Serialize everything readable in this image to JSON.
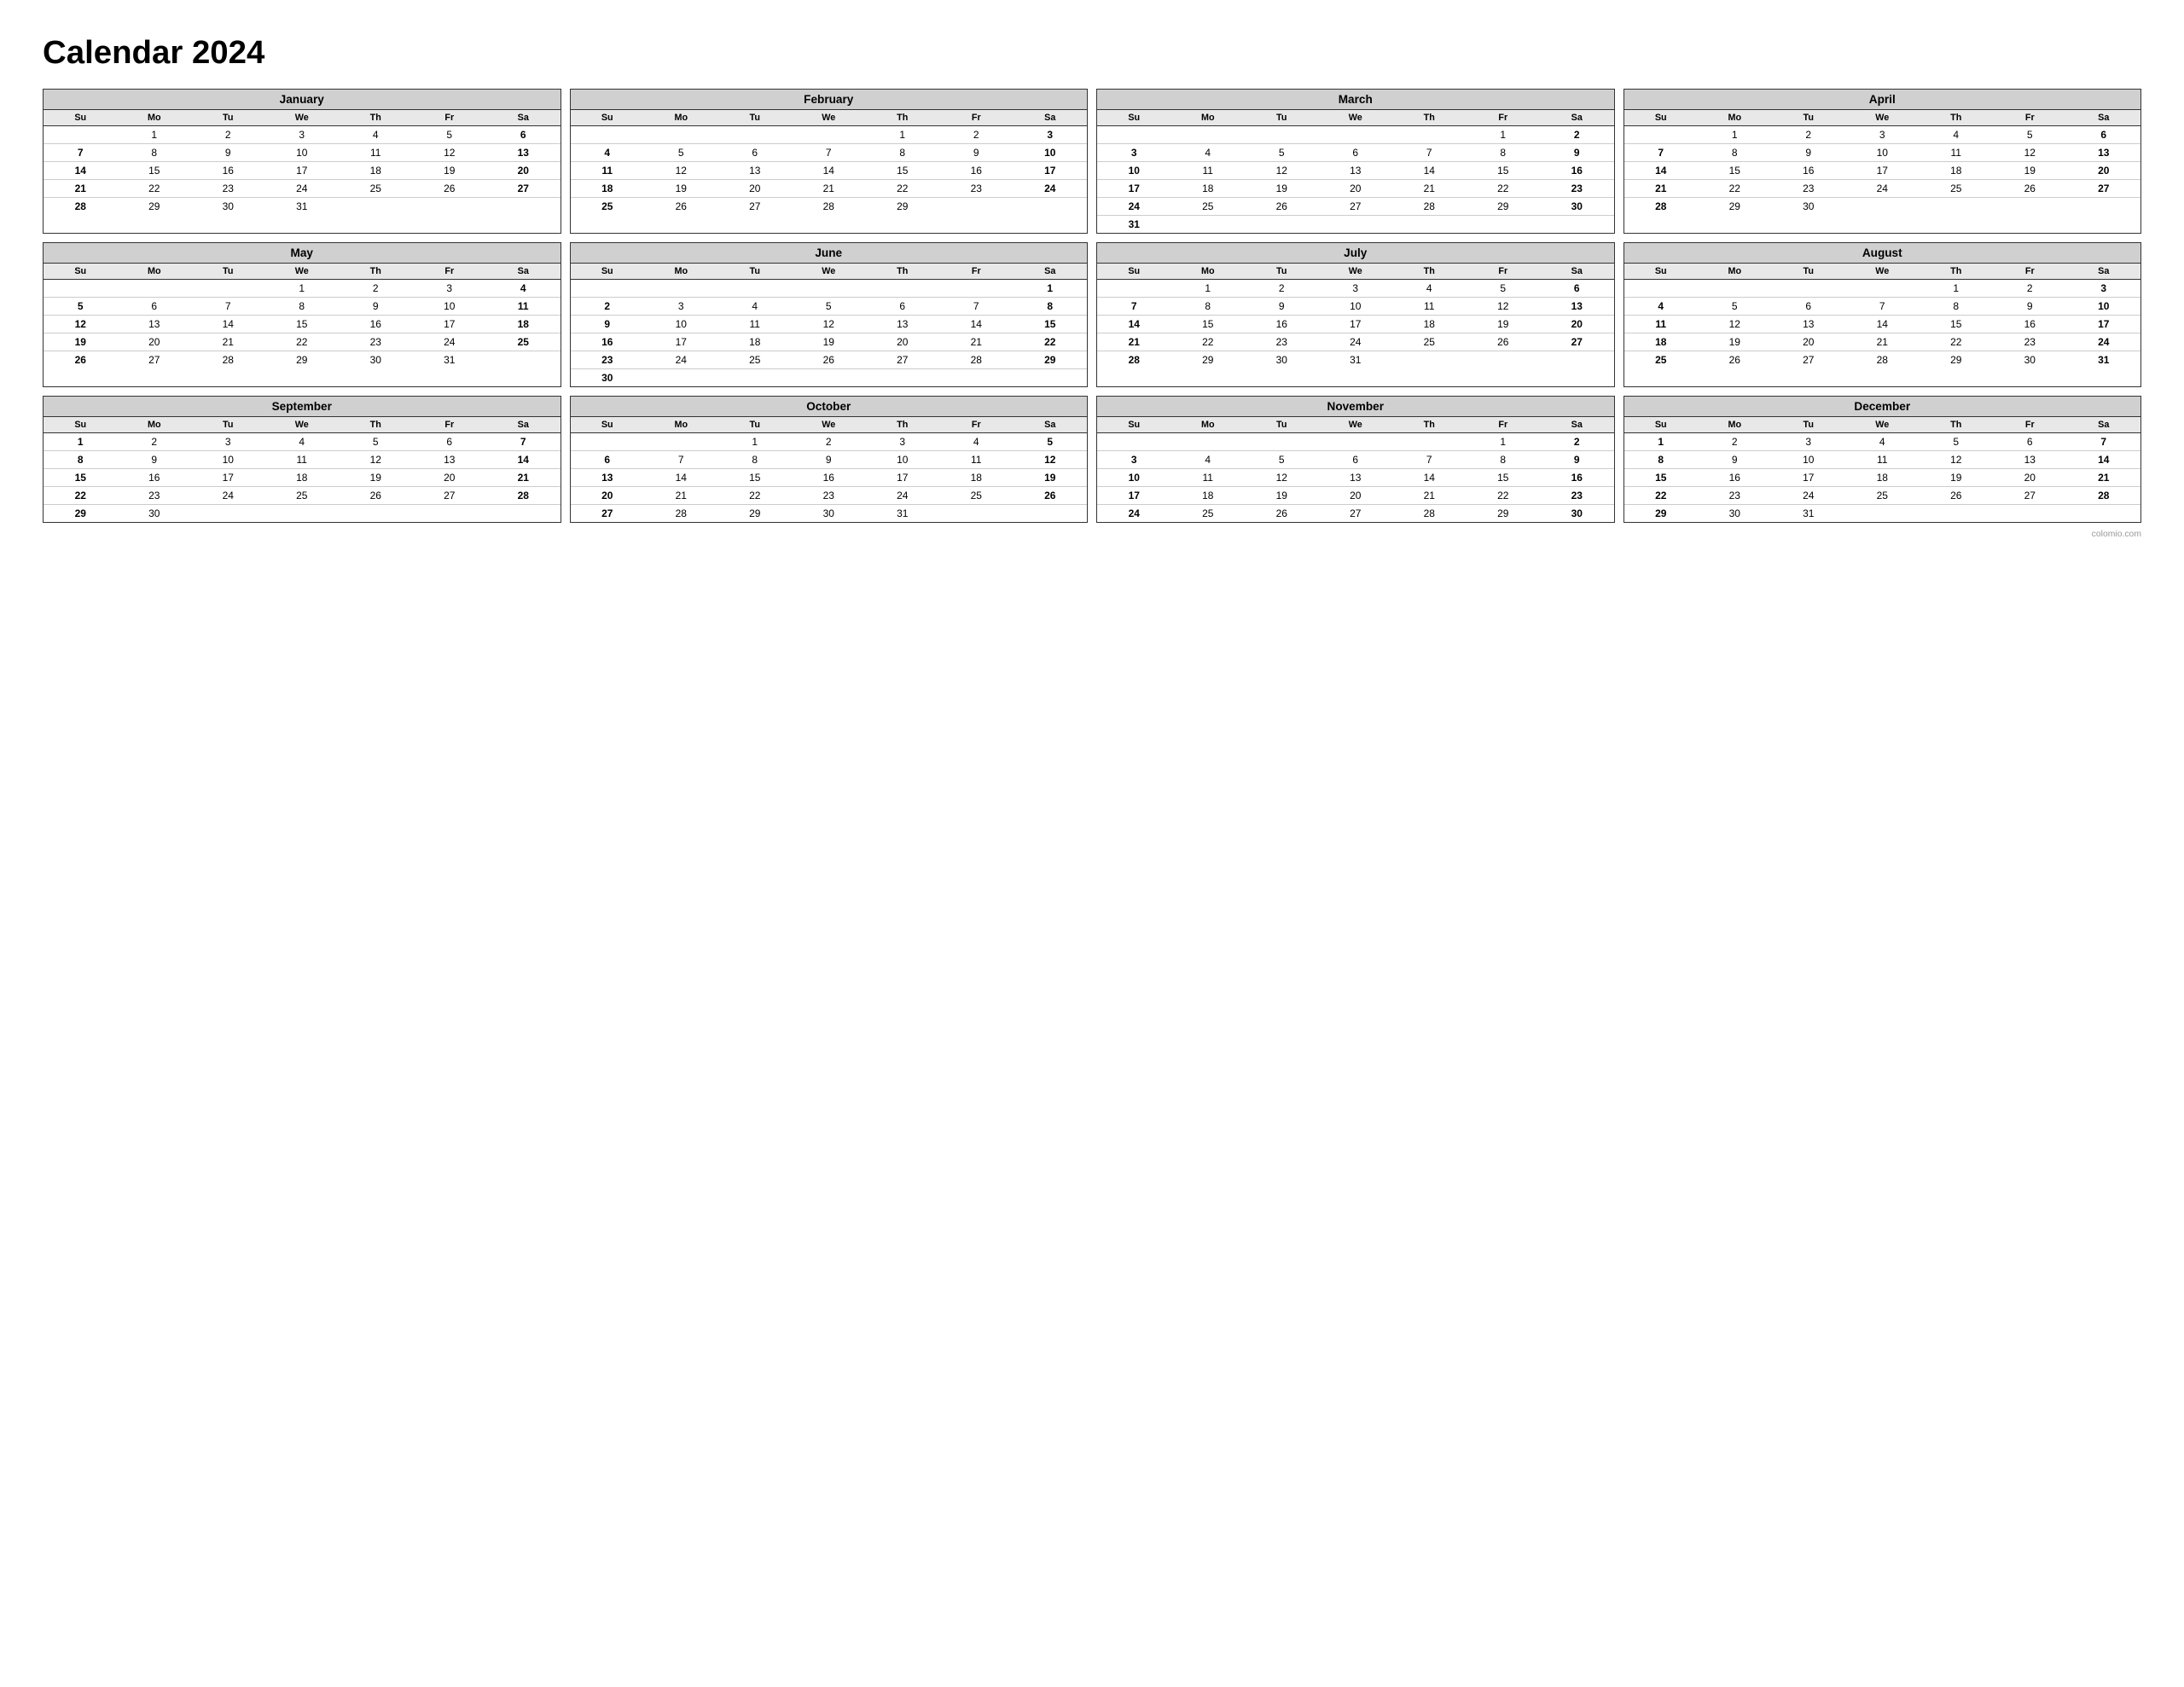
{
  "title": "Calendar 2024",
  "footer": "colomio.com",
  "months": [
    {
      "name": "January",
      "weeks": [
        [
          "",
          "1",
          "2",
          "3",
          "4",
          "5",
          "6"
        ],
        [
          "7",
          "8",
          "9",
          "10",
          "11",
          "12",
          "13"
        ],
        [
          "14",
          "15",
          "16",
          "17",
          "18",
          "19",
          "20"
        ],
        [
          "21",
          "22",
          "23",
          "24",
          "25",
          "26",
          "27"
        ],
        [
          "28",
          "29",
          "30",
          "31",
          "",
          "",
          ""
        ]
      ]
    },
    {
      "name": "February",
      "weeks": [
        [
          "",
          "",
          "",
          "",
          "1",
          "2",
          "3"
        ],
        [
          "4",
          "5",
          "6",
          "7",
          "8",
          "9",
          "10"
        ],
        [
          "11",
          "12",
          "13",
          "14",
          "15",
          "16",
          "17"
        ],
        [
          "18",
          "19",
          "20",
          "21",
          "22",
          "23",
          "24"
        ],
        [
          "25",
          "26",
          "27",
          "28",
          "29",
          "",
          ""
        ]
      ]
    },
    {
      "name": "March",
      "weeks": [
        [
          "",
          "",
          "",
          "",
          "",
          "1",
          "2"
        ],
        [
          "3",
          "4",
          "5",
          "6",
          "7",
          "8",
          "9"
        ],
        [
          "10",
          "11",
          "12",
          "13",
          "14",
          "15",
          "16"
        ],
        [
          "17",
          "18",
          "19",
          "20",
          "21",
          "22",
          "23"
        ],
        [
          "24",
          "25",
          "26",
          "27",
          "28",
          "29",
          "30"
        ],
        [
          "31",
          "",
          "",
          "",
          "",
          "",
          ""
        ]
      ]
    },
    {
      "name": "April",
      "weeks": [
        [
          "",
          "1",
          "2",
          "3",
          "4",
          "5",
          "6"
        ],
        [
          "7",
          "8",
          "9",
          "10",
          "11",
          "12",
          "13"
        ],
        [
          "14",
          "15",
          "16",
          "17",
          "18",
          "19",
          "20"
        ],
        [
          "21",
          "22",
          "23",
          "24",
          "25",
          "26",
          "27"
        ],
        [
          "28",
          "29",
          "30",
          "",
          "",
          "",
          ""
        ]
      ]
    },
    {
      "name": "May",
      "weeks": [
        [
          "",
          "",
          "",
          "1",
          "2",
          "3",
          "4"
        ],
        [
          "5",
          "6",
          "7",
          "8",
          "9",
          "10",
          "11"
        ],
        [
          "12",
          "13",
          "14",
          "15",
          "16",
          "17",
          "18"
        ],
        [
          "19",
          "20",
          "21",
          "22",
          "23",
          "24",
          "25"
        ],
        [
          "26",
          "27",
          "28",
          "29",
          "30",
          "31",
          ""
        ]
      ]
    },
    {
      "name": "June",
      "weeks": [
        [
          "",
          "",
          "",
          "",
          "",
          "",
          "1"
        ],
        [
          "2",
          "3",
          "4",
          "5",
          "6",
          "7",
          "8"
        ],
        [
          "9",
          "10",
          "11",
          "12",
          "13",
          "14",
          "15"
        ],
        [
          "16",
          "17",
          "18",
          "19",
          "20",
          "21",
          "22"
        ],
        [
          "23",
          "24",
          "25",
          "26",
          "27",
          "28",
          "29"
        ],
        [
          "30",
          "",
          "",
          "",
          "",
          "",
          ""
        ]
      ]
    },
    {
      "name": "July",
      "weeks": [
        [
          "",
          "1",
          "2",
          "3",
          "4",
          "5",
          "6"
        ],
        [
          "7",
          "8",
          "9",
          "10",
          "11",
          "12",
          "13"
        ],
        [
          "14",
          "15",
          "16",
          "17",
          "18",
          "19",
          "20"
        ],
        [
          "21",
          "22",
          "23",
          "24",
          "25",
          "26",
          "27"
        ],
        [
          "28",
          "29",
          "30",
          "31",
          "",
          "",
          ""
        ]
      ]
    },
    {
      "name": "August",
      "weeks": [
        [
          "",
          "",
          "",
          "",
          "1",
          "2",
          "3"
        ],
        [
          "4",
          "5",
          "6",
          "7",
          "8",
          "9",
          "10"
        ],
        [
          "11",
          "12",
          "13",
          "14",
          "15",
          "16",
          "17"
        ],
        [
          "18",
          "19",
          "20",
          "21",
          "22",
          "23",
          "24"
        ],
        [
          "25",
          "26",
          "27",
          "28",
          "29",
          "30",
          "31"
        ]
      ]
    },
    {
      "name": "September",
      "weeks": [
        [
          "1",
          "2",
          "3",
          "4",
          "5",
          "6",
          "7"
        ],
        [
          "8",
          "9",
          "10",
          "11",
          "12",
          "13",
          "14"
        ],
        [
          "15",
          "16",
          "17",
          "18",
          "19",
          "20",
          "21"
        ],
        [
          "22",
          "23",
          "24",
          "25",
          "26",
          "27",
          "28"
        ],
        [
          "29",
          "30",
          "",
          "",
          "",
          "",
          ""
        ]
      ]
    },
    {
      "name": "October",
      "weeks": [
        [
          "",
          "",
          "1",
          "2",
          "3",
          "4",
          "5"
        ],
        [
          "6",
          "7",
          "8",
          "9",
          "10",
          "11",
          "12"
        ],
        [
          "13",
          "14",
          "15",
          "16",
          "17",
          "18",
          "19"
        ],
        [
          "20",
          "21",
          "22",
          "23",
          "24",
          "25",
          "26"
        ],
        [
          "27",
          "28",
          "29",
          "30",
          "31",
          "",
          ""
        ]
      ]
    },
    {
      "name": "November",
      "weeks": [
        [
          "",
          "",
          "",
          "",
          "",
          "1",
          "2"
        ],
        [
          "3",
          "4",
          "5",
          "6",
          "7",
          "8",
          "9"
        ],
        [
          "10",
          "11",
          "12",
          "13",
          "14",
          "15",
          "16"
        ],
        [
          "17",
          "18",
          "19",
          "20",
          "21",
          "22",
          "23"
        ],
        [
          "24",
          "25",
          "26",
          "27",
          "28",
          "29",
          "30"
        ]
      ]
    },
    {
      "name": "December",
      "weeks": [
        [
          "1",
          "2",
          "3",
          "4",
          "5",
          "6",
          "7"
        ],
        [
          "8",
          "9",
          "10",
          "11",
          "12",
          "13",
          "14"
        ],
        [
          "15",
          "16",
          "17",
          "18",
          "19",
          "20",
          "21"
        ],
        [
          "22",
          "23",
          "24",
          "25",
          "26",
          "27",
          "28"
        ],
        [
          "29",
          "30",
          "31",
          "",
          "",
          "",
          ""
        ]
      ]
    }
  ],
  "day_headers": [
    "Su",
    "Mo",
    "Tu",
    "We",
    "Th",
    "Fr",
    "Sa"
  ]
}
